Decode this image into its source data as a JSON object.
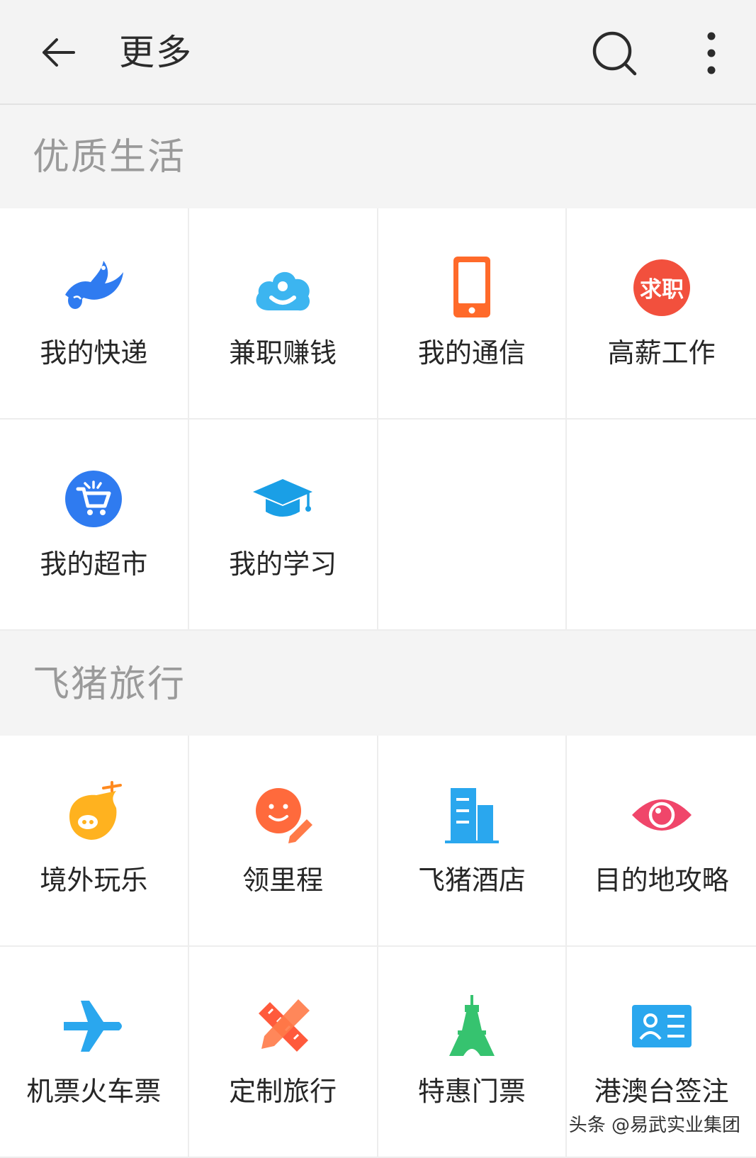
{
  "header": {
    "title": "更多"
  },
  "sections": [
    {
      "title": "优质生活",
      "items": [
        {
          "label": "我的快递",
          "icon": "bird-icon"
        },
        {
          "label": "兼职赚钱",
          "icon": "cloud-person-icon"
        },
        {
          "label": "我的通信",
          "icon": "phone-icon"
        },
        {
          "label": "高薪工作",
          "icon": "job-badge-icon",
          "icon_text": "求职"
        },
        {
          "label": "我的超市",
          "icon": "cart-icon"
        },
        {
          "label": "我的学习",
          "icon": "grad-cap-icon"
        }
      ]
    },
    {
      "title": "飞猪旅行",
      "items": [
        {
          "label": "境外玩乐",
          "icon": "pig-plane-icon"
        },
        {
          "label": "领里程",
          "icon": "smile-pencil-icon"
        },
        {
          "label": "飞猪酒店",
          "icon": "hotel-building-icon"
        },
        {
          "label": "目的地攻略",
          "icon": "eye-icon"
        },
        {
          "label": "机票火车票",
          "icon": "airplane-icon"
        },
        {
          "label": "定制旅行",
          "icon": "pencil-ruler-icon"
        },
        {
          "label": "特惠门票",
          "icon": "tower-icon"
        },
        {
          "label": "港澳台签注",
          "icon": "id-card-icon"
        }
      ]
    }
  ],
  "watermark": "头条 @易武实业集团",
  "colors": {
    "blue": "#2f7bf0",
    "orange": "#ff6a2a",
    "red": "#f2503d",
    "pink": "#f0466a",
    "green": "#36c36f"
  }
}
